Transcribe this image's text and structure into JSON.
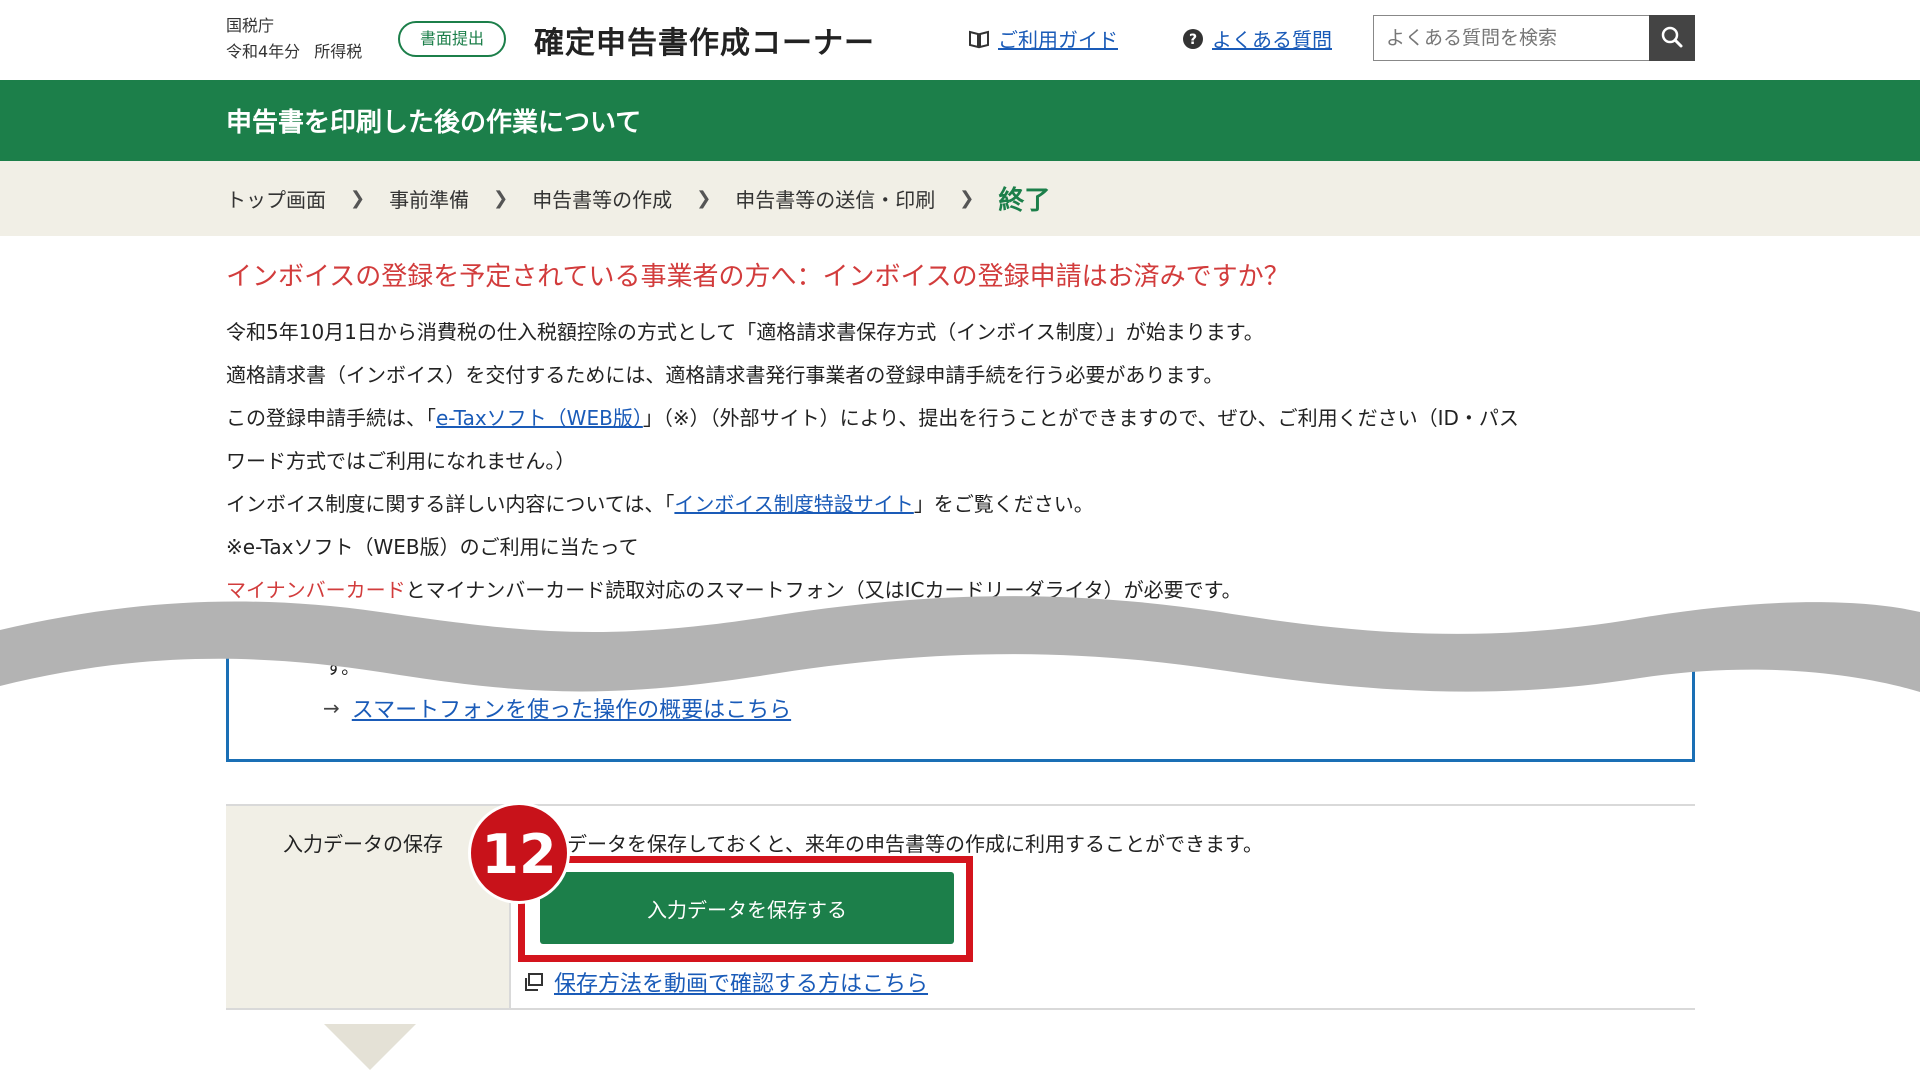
{
  "header": {
    "agency": "国税庁",
    "year": "令和4年分",
    "tax": "所得税",
    "paper_badge": "書面提出",
    "site_title": "確定申告書作成コーナー",
    "guide_link": "ご利用ガイド",
    "faq_link": "よくある質問",
    "search_placeholder": "よくある質問を検索"
  },
  "band": {
    "title": "申告書を印刷した後の作業について"
  },
  "breadcrumb": {
    "items": [
      "トップ画面",
      "事前準備",
      "申告書等の作成",
      "申告書等の送信・印刷"
    ],
    "current": "終了"
  },
  "notice": {
    "title": "インボイスの登録を予定されている事業者の方へ：インボイスの登録申請はお済みですか？",
    "p1": "令和5年10月1日から消費税の仕入税額控除の方式として「適格請求書保存方式（インボイス制度）」が始まります。",
    "p2": "適格請求書（インボイス）を交付するためには、適格請求書発行事業者の登録申請手続を行う必要があります。",
    "p3_pre": "この登録申請手続は、「",
    "p3_link": "e-Taxソフト（WEB版）",
    "p3_post": "」（※）（外部サイト）により、提出を行うことができますので、ぜひ、ご利用ください（ID・パス",
    "p4": "ワード方式ではご利用になれません。）",
    "p5_pre": "インボイス制度に関する詳しい内容については、「",
    "p5_link": "インボイス制度特設サイト",
    "p5_post": "」をご覧ください。",
    "p6": "※e-Taxソフト（WEB版）のご利用に当たって",
    "p7_red": "マイナンバーカード",
    "p7_post": "とマイナンバーカード読取対応のスマートフォン（又はICカードリーダライタ）が必要です。",
    "box_text": "す。",
    "box_link": "スマートフォンを使った操作の概要はこちら"
  },
  "save": {
    "label": "入力データの保存",
    "description": "データを保存しておくと、来年の申告書等の作成に利用することができます。",
    "button": "入力データを保存する",
    "step_number": "12",
    "video_link": "保存方法を動画で確認する方はこちら"
  },
  "colors": {
    "brand_green": "#1c7f4a",
    "link_blue": "#1a5bb8",
    "alert_red": "#d23c3c",
    "highlight_red": "#d4141d",
    "crumb_bg": "#f1efe6"
  }
}
